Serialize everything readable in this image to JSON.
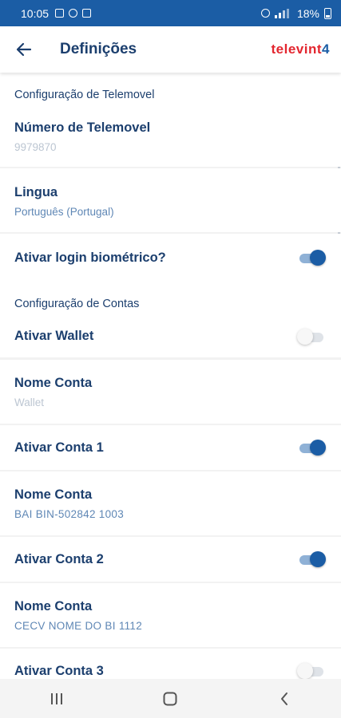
{
  "status_bar": {
    "time": "10:05",
    "battery": "18%"
  },
  "app_bar": {
    "title": "Definições",
    "logo_text": "televint",
    "logo_suffix": "4"
  },
  "sections": {
    "phone_config_title": "Configuração de Telemovel",
    "phone_number_label": "Número de Telemovel",
    "phone_number_value": "9979870",
    "language_label": "Lingua",
    "language_value": "Português (Portugal)",
    "biometric_label": "Ativar login biométrico?",
    "biometric_enabled": true,
    "accounts_config_title": "Configuração de Contas",
    "wallet_label": "Ativar Wallet",
    "wallet_enabled": false,
    "wallet_name_label": "Nome Conta",
    "wallet_name_value": "Wallet",
    "account1_label": "Ativar Conta 1",
    "account1_enabled": true,
    "account1_name_label": "Nome Conta",
    "account1_name_value": "BAI BIN-502842 1003",
    "account2_label": "Ativar Conta 2",
    "account2_enabled": true,
    "account2_name_label": "Nome Conta",
    "account2_name_value": "CECV NOME DO BI 1112",
    "account3_label": "Ativar Conta 3",
    "account3_enabled": false
  },
  "colors": {
    "primary": "#1b5da5",
    "text": "#1c3f6e",
    "secondary_text": "#5f87b5",
    "logo_red": "#e3262f"
  },
  "icons": {
    "back": "arrow-left-icon",
    "nav_recents": "recents-icon",
    "nav_home": "home-icon",
    "nav_back": "chevron-left-icon"
  }
}
